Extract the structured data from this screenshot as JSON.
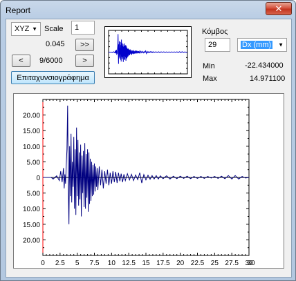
{
  "window": {
    "title": "Report",
    "close_glyph": "✕"
  },
  "controls": {
    "axis_select": "XYZ",
    "scale_label": "Scale",
    "scale_value": "1",
    "scale_display": "0.045",
    "fast_forward_label": ">>",
    "prev_label": "<",
    "next_label": ">",
    "frame_counter": "9/6000",
    "accelerogram_button": "Επιταχυνσιογράφημα",
    "node_label": "Κόμβος",
    "node_value": "29",
    "component_select": "Dx (mm)",
    "min_label": "Min",
    "min_value": "-22.434000",
    "max_label": "Max",
    "max_value": "14.971100"
  },
  "colors": {
    "signal": "#000080",
    "origin_axis": "#ff0000",
    "window_frame": "#b9cde4"
  },
  "chart_data": {
    "type": "line",
    "title": "",
    "xlabel": "",
    "ylabel": "",
    "xlim": [
      0,
      30
    ],
    "ylim": [
      -25,
      25
    ],
    "x_ticks": [
      "0",
      "2.5",
      "5",
      "7.5",
      "10",
      "12.5",
      "15",
      "17.5",
      "20",
      "22.5",
      "25",
      "27.5",
      "30",
      "30"
    ],
    "y_ticks": [
      "20.00",
      "15.00",
      "10.00",
      "5.00",
      "0",
      "5.00",
      "10.00",
      "15.00",
      "20.00"
    ],
    "grid": false,
    "series": [
      {
        "x": [
          0,
          1.2,
          1.5,
          2.0,
          2.4,
          2.6,
          2.8,
          3.0,
          3.1,
          3.2,
          3.3,
          3.4,
          3.5,
          3.6,
          3.7,
          3.8,
          3.9,
          4.0,
          4.1,
          4.2,
          4.3,
          4.4,
          4.5,
          4.6,
          4.7,
          4.8,
          4.9,
          5.0,
          5.1,
          5.2,
          5.3,
          5.4,
          5.5,
          5.6,
          5.7,
          5.8,
          5.9,
          6.0,
          6.1,
          6.2,
          6.3,
          6.4,
          6.5,
          6.6,
          6.7,
          6.8,
          6.9,
          7.0,
          7.1,
          7.2,
          7.3,
          7.4,
          7.5,
          7.6,
          7.7,
          7.8,
          7.9,
          8.0,
          8.2,
          8.4,
          8.6,
          8.8,
          9.0,
          9.2,
          9.4,
          9.6,
          9.8,
          10.0,
          10.2,
          10.4,
          10.6,
          10.8,
          11.0,
          11.2,
          11.4,
          11.6,
          11.8,
          12.0,
          12.3,
          12.6,
          12.9,
          13.2,
          13.5,
          13.8,
          14.1,
          14.4,
          14.7,
          15.0,
          15.3,
          15.6,
          15.9,
          16.2,
          16.5,
          16.8,
          17.1,
          17.5,
          18.0,
          18.5,
          19.0,
          19.5,
          20.0,
          20.5,
          21.0,
          21.5,
          22.0,
          22.5,
          23.0,
          23.5,
          24.0,
          24.5,
          25.0,
          25.5,
          26.0,
          26.5,
          27.0,
          27.5,
          28.0,
          28.5,
          29.0,
          29.5,
          30.0
        ],
        "y": [
          0,
          0,
          -0.5,
          0.5,
          -1.0,
          2.0,
          -1.5,
          3.0,
          -3.5,
          1.0,
          -2.0,
          4.0,
          9.0,
          23.0,
          -4.0,
          -15.0,
          10.0,
          -6.0,
          14.0,
          -8.0,
          5.0,
          -3.0,
          13.0,
          -10.0,
          9.0,
          -12.0,
          16.0,
          -6.0,
          12.0,
          -9.0,
          8.0,
          -7.0,
          10.5,
          -12.5,
          7.0,
          -5.0,
          8.5,
          -9.5,
          11.0,
          -10.0,
          7.5,
          -6.5,
          9.0,
          -11.0,
          8.0,
          -8.5,
          6.0,
          -7.5,
          5.0,
          -6.0,
          4.0,
          -5.5,
          4.5,
          -4.5,
          3.5,
          -3.0,
          3.0,
          -4.0,
          3.5,
          -2.5,
          2.5,
          -3.5,
          2.0,
          -2.0,
          2.5,
          -2.5,
          1.5,
          -2.0,
          2.0,
          -1.5,
          1.8,
          -1.8,
          1.5,
          -1.2,
          1.2,
          -1.5,
          1.0,
          -1.0,
          1.2,
          -0.8,
          1.0,
          -1.0,
          0.8,
          -0.7,
          1.5,
          -1.8,
          0.9,
          -0.8,
          0.7,
          -0.6,
          0.6,
          -0.5,
          0.6,
          -0.5,
          0.5,
          -0.4,
          0.5,
          -0.5,
          0.4,
          -0.4,
          0.4,
          -0.3,
          0.4,
          -0.4,
          0.3,
          -0.3,
          0.3,
          -0.3,
          0.3,
          -0.2,
          0.3,
          -0.3,
          0.4,
          -0.4,
          0.6,
          -0.5,
          0.6,
          -0.5,
          0.3,
          -0.2,
          0
        ]
      }
    ]
  }
}
